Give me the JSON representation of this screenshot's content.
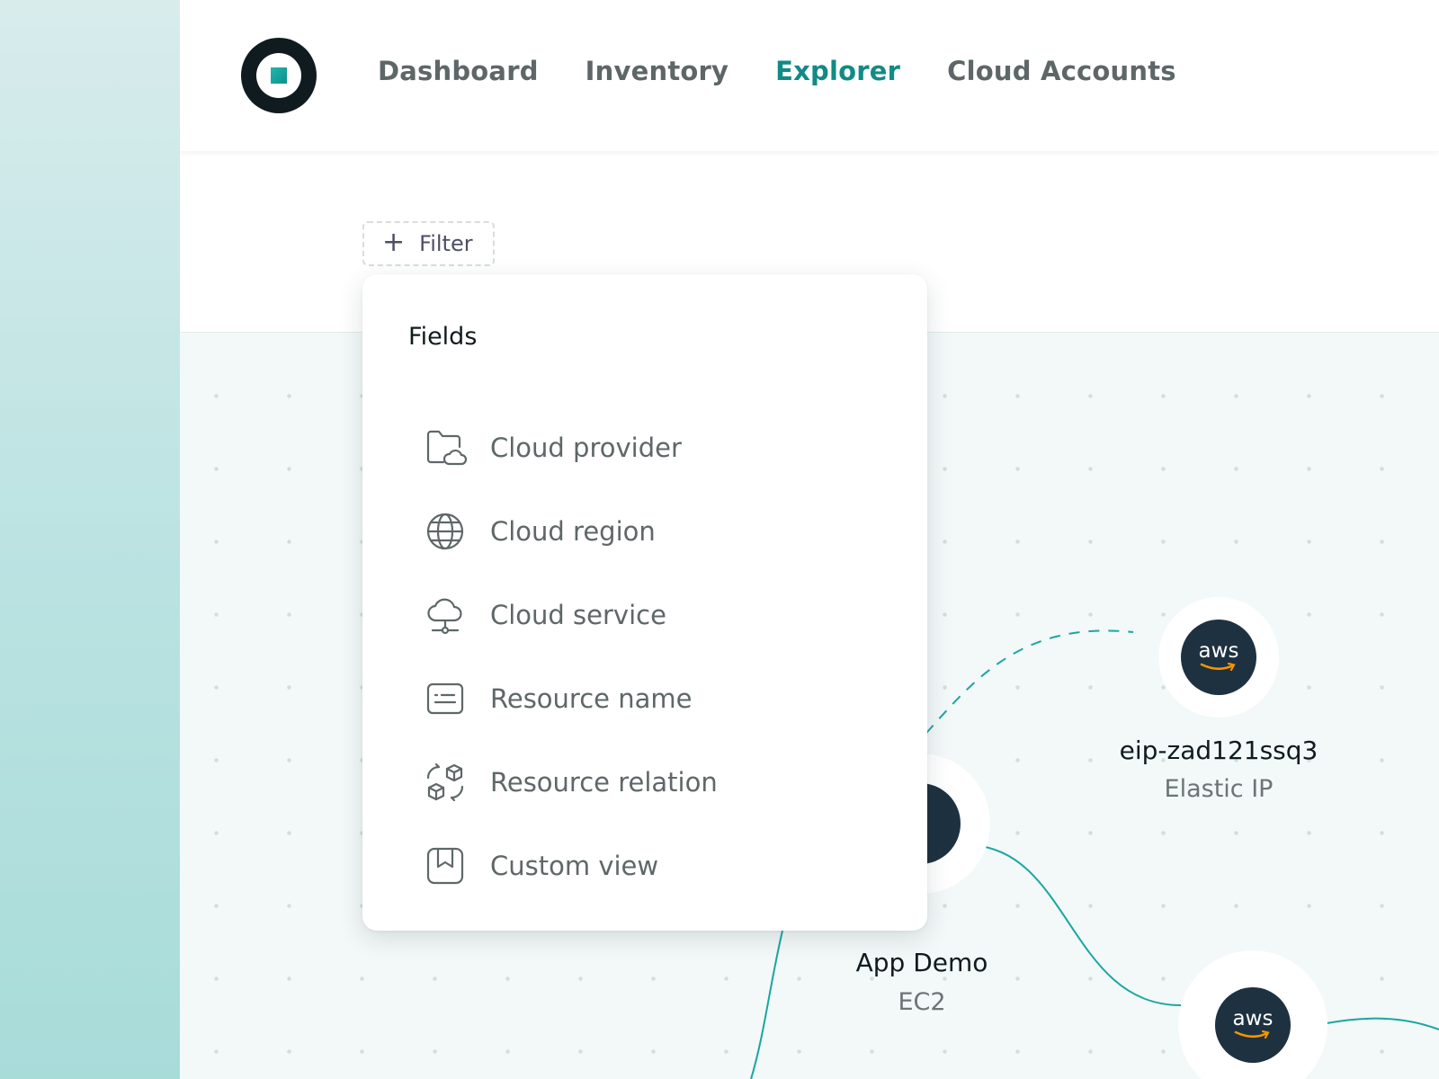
{
  "nav": {
    "items": [
      {
        "label": "Dashboard",
        "active": false
      },
      {
        "label": "Inventory",
        "active": false
      },
      {
        "label": "Explorer",
        "active": true
      },
      {
        "label": "Cloud Accounts",
        "active": false
      }
    ]
  },
  "filter": {
    "plus": "+",
    "label": "Filter"
  },
  "dropdown": {
    "title": "Fields",
    "items": [
      {
        "label": "Cloud provider",
        "icon": "folder-cloud-icon"
      },
      {
        "label": "Cloud region",
        "icon": "globe-icon"
      },
      {
        "label": "Cloud service",
        "icon": "cloud-network-icon"
      },
      {
        "label": "Resource name",
        "icon": "id-card-icon"
      },
      {
        "label": "Resource relation",
        "icon": "relation-cubes-icon"
      },
      {
        "label": "Custom view",
        "icon": "bookmark-icon"
      }
    ]
  },
  "graph": {
    "nodes": [
      {
        "id": "eip",
        "logo": "aws",
        "title": "eip-zad121ssq3",
        "subtitle": "Elastic IP"
      },
      {
        "id": "app",
        "logo": "",
        "title": "App Demo",
        "subtitle": "EC2"
      },
      {
        "id": "third",
        "logo": "aws",
        "title": "",
        "subtitle": ""
      }
    ]
  },
  "colors": {
    "accent": "#128a86",
    "edge": "#1aa6a0",
    "node_dark": "#1e3140",
    "aws_smile": "#f79400"
  }
}
